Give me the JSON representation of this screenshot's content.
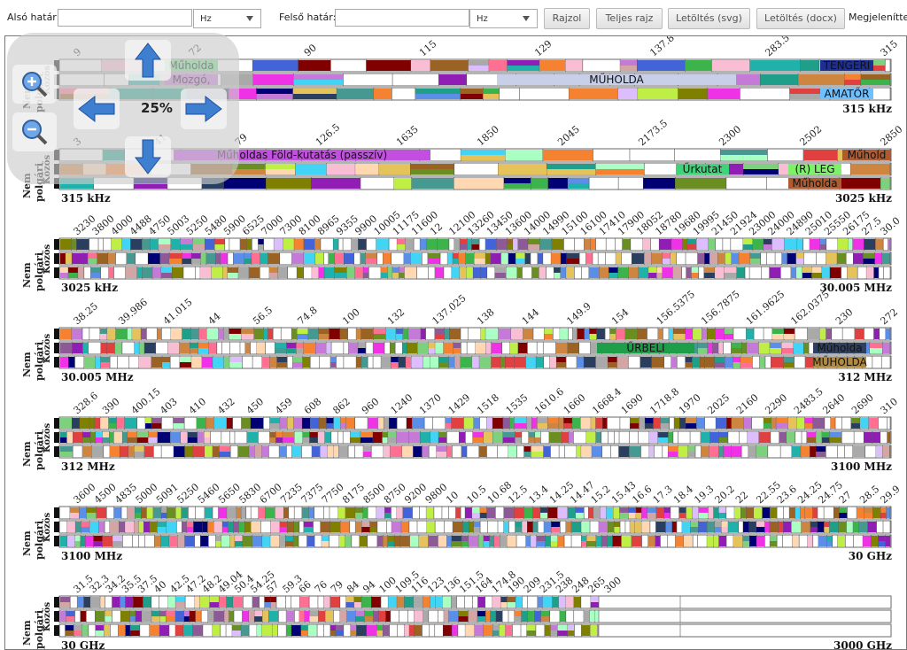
{
  "toolbar": {
    "lower_label": "Alsó határ:",
    "lower_value": "",
    "lower_unit": "Hz",
    "upper_label": "Felső határ:",
    "upper_value": "",
    "upper_unit": "Hz",
    "draw_button": "Rajzol",
    "full_button": "Teljes rajz",
    "svg_button": "Letöltés (svg)",
    "docx_button": "Letöltés (docx)",
    "display_label": "Megjelenítte"
  },
  "zoom": {
    "level": "25%"
  },
  "row_labels": {
    "line1": "Nem",
    "line2": "polgári",
    "line3": "Közös",
    "line4": "Polgári"
  },
  "bands": [
    {
      "start": "",
      "end": "315 kHz",
      "ticks": [
        "9",
        "72",
        "90",
        "115",
        "129",
        "137.8",
        "283.5",
        "315"
      ],
      "labels": [
        {
          "text": "Műholda",
          "row": 0
        },
        {
          "text": "Mozgó,",
          "row": 1
        },
        {
          "text": "TENGERI",
          "row": 0
        },
        {
          "text": "MŰHOLDA",
          "row": 1
        },
        {
          "text": "AMATŐR",
          "row": 2
        }
      ]
    },
    {
      "start": "315 kHz",
      "end": "3025 kHz",
      "ticks": [
        "3",
        "41",
        "79",
        "126.5",
        "1635",
        "1850",
        "2045",
        "2173.5",
        "2300",
        "2502",
        "2850"
      ],
      "labels": [
        {
          "text": "Műholdas Föld-kutatás (passzív)",
          "row": 0
        },
        {
          "text": "Műhold",
          "row": 0
        },
        {
          "text": "Űrkutat",
          "row": 1
        },
        {
          "text": "(R) LEG",
          "row": 1
        },
        {
          "text": "Műholda",
          "row": 2
        }
      ]
    },
    {
      "start": "3025 kHz",
      "end": "30.005 MHz",
      "ticks": [
        "3230",
        "3800",
        "4000",
        "4488",
        "4750",
        "5003",
        "5250",
        "5480",
        "5900",
        "6525",
        "7000",
        "7300",
        "8100",
        "8965",
        "9355",
        "9900",
        "10005",
        "11175",
        "11600",
        "12",
        "12100",
        "13260",
        "13450",
        "13600",
        "14000",
        "14990",
        "15100",
        "16100",
        "17410",
        "17900",
        "18052",
        "18780",
        "19680",
        "19995",
        "21450",
        "21924",
        "23000",
        "24000",
        "24890",
        "25010",
        "25550",
        "26175",
        "27.5",
        "30.0"
      ],
      "labels": []
    },
    {
      "start": "30.005 MHz",
      "end": "312 MHz",
      "ticks": [
        "38.25",
        "39.986",
        "41.015",
        "44",
        "56.5",
        "74.8",
        "100",
        "132",
        "137.025",
        "138",
        "144",
        "149.9",
        "154",
        "156.5375",
        "156.7875",
        "161.9625",
        "162.0375",
        "230",
        "272"
      ],
      "labels": [
        {
          "text": "ŰRBELI",
          "row": 1
        },
        {
          "text": "Műholda",
          "row": 1
        },
        {
          "text": "MŰHOLDA",
          "row": 2
        }
      ]
    },
    {
      "start": "312 MHz",
      "end": "3100 MHz",
      "ticks": [
        "328.6",
        "390",
        "400.15",
        "403",
        "410",
        "432",
        "450",
        "459",
        "608",
        "862",
        "960",
        "1240",
        "1370",
        "1429",
        "1518",
        "1535",
        "1610.6",
        "1660",
        "1668.4",
        "1690",
        "1718.8",
        "1970",
        "2025",
        "2160",
        "2290",
        "2483.5",
        "2640",
        "2690",
        "310"
      ],
      "labels": []
    },
    {
      "start": "3100 MHz",
      "end": "30 GHz",
      "ticks": [
        "3600",
        "4500",
        "4835",
        "5000",
        "5091",
        "5250",
        "5460",
        "5650",
        "5830",
        "6700",
        "7235",
        "7375",
        "7750",
        "8175",
        "8500",
        "8750",
        "9200",
        "9800",
        "10",
        "10.5",
        "10.68",
        "12.5",
        "13.4",
        "14.25",
        "14.47",
        "15.2",
        "15.43",
        "16.6",
        "17.3",
        "18.4",
        "19.3",
        "20.2",
        "22",
        "22.55",
        "23.6",
        "24.25",
        "24.75",
        "27",
        "28.5",
        "29.9"
      ],
      "labels": []
    },
    {
      "start": "30 GHz",
      "end": "3000 GHz",
      "ticks": [
        "31.5",
        "32.3",
        "34.2",
        "35.5",
        "37.5",
        "40",
        "42.5",
        "47.2",
        "48.2",
        "49.04",
        "50.4",
        "54.25",
        "57",
        "59.3",
        "66",
        "76",
        "79",
        "84",
        "94",
        "100",
        "109.5",
        "116",
        "123",
        "136",
        "151.5",
        "164",
        "174.8",
        "190",
        "209",
        "231.5",
        "238",
        "248",
        "265",
        "300"
      ],
      "labels": []
    }
  ],
  "palette": [
    "#e04040",
    "#3cb44b",
    "#4363d8",
    "#f58231",
    "#911eb4",
    "#42d4f4",
    "#f032e6",
    "#bfef45",
    "#fabed4",
    "#469990",
    "#dcbeff",
    "#9a6324",
    "#e6c35a",
    "#800000",
    "#aaffc3",
    "#808000",
    "#ffd8b1",
    "#000075",
    "#a9a9a9",
    "#2a3f5f",
    "#d4a5a5",
    "#7dd17d",
    "#5b8ee6",
    "#c47ad6",
    "#1f9e89",
    "#ff6f91",
    "#8d5a97",
    "#6b8e23",
    "#cd853f",
    "#20b2aa"
  ]
}
